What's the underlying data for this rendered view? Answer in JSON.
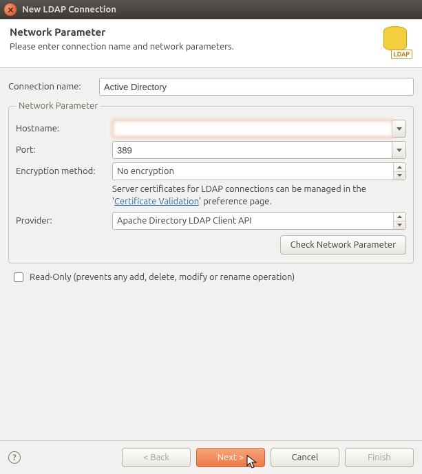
{
  "window": {
    "title": "New LDAP Connection"
  },
  "header": {
    "title": "Network Parameter",
    "subtitle": "Please enter connection name and network parameters.",
    "icon_badge": "LDAP"
  },
  "form": {
    "connection_name_label": "Connection name:",
    "connection_name_value": "Active Directory"
  },
  "fieldset": {
    "legend": "Network Parameter",
    "hostname_label": "Hostname:",
    "hostname_value": "",
    "port_label": "Port:",
    "port_value": "389",
    "encryption_label": "Encryption method:",
    "encryption_value": "No encryption",
    "cert_hint_prefix": "Server certificates for LDAP connections can be managed in the '",
    "cert_hint_link": "Certificate Validation",
    "cert_hint_suffix": "' preference page.",
    "provider_label": "Provider:",
    "provider_value": "Apache Directory LDAP Client API",
    "check_button": "Check Network Parameter"
  },
  "readonly": {
    "label": "Read-Only (prevents any add, delete, modify or rename operation)",
    "checked": false
  },
  "footer": {
    "back": "< Back",
    "next": "Next >",
    "cancel": "Cancel",
    "finish": "Finish"
  }
}
